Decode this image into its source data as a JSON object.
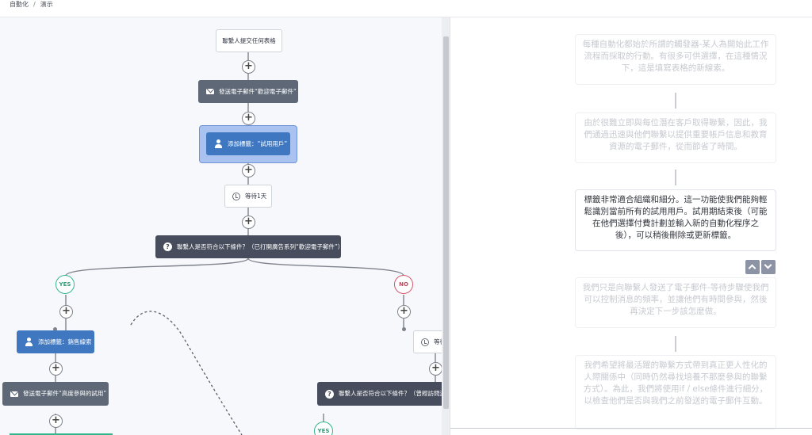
{
  "breadcrumb": {
    "root": "自動化",
    "separator": "/",
    "current": "演示"
  },
  "flow": {
    "trigger": "聯繫人提交任何表格",
    "send_welcome": "發送電子郵件“歡迎電子郵件”",
    "add_tag_trial": "添加標籤：“試用用戶”",
    "wait": "等待1天",
    "condition_opened": "聯繫人是否符合以下條件？（已打開廣告系列“歡迎電子郵件”）",
    "yes_label": "YES",
    "no_label": "NO",
    "add_tag_sales": "添加標籤：銷售線索",
    "send_high_engage": "發送電子郵件“高度參與的試用”",
    "wait_partial": "等待",
    "condition_visited": "聯繫人是否符合以下條件？（曾經訪問過",
    "yes_label_2": "YES",
    "plus_symbol": "+"
  },
  "tour": {
    "cards": [
      "每種自動化都始於所謂的觸發器-某人為開始此工作流程而採取的行動。有很多可供選擇，在這種情況下，這是填寫表格的新線索。",
      "由於很難立即與每位潛在客戶取得聯繫，因此，我們通過迅速與他們聯繫以提供重要帳戶信息和教育資源的電子郵件，從而節省了時間。",
      "標籤非常適合組織和細分。這一功能使我們能夠輕鬆識別當前所有的試用用戶。試用期結束後（可能在他們選擇付費計劃並輸入新的自動化程序之後），可以稍後刪除或更新標籤。",
      "我們只是向聯繫人發送了電子郵件-等待步驟使我們可以控制消息的頻率，並讓他們有時間參與，然後再決定下一步該怎麼做。",
      "我們希望將最活躍的聯繫方式帶到真正更人性化的人際關係中（同時仍然尋找培養不那麼參與的聯繫方式）。為此，我們將使用if / else條件進行細分，以檢查他們是否與我們之前發送的電子郵件互動。"
    ]
  },
  "colors": {
    "accent_blue": "#3f78c1",
    "dark_node": "#5e6877",
    "yes_green": "#33b58c",
    "no_red": "#d5556a"
  },
  "icons": [
    "envelope-icon",
    "person-icon",
    "question-icon",
    "clock-icon",
    "chevron-up-icon",
    "chevron-down-icon"
  ]
}
